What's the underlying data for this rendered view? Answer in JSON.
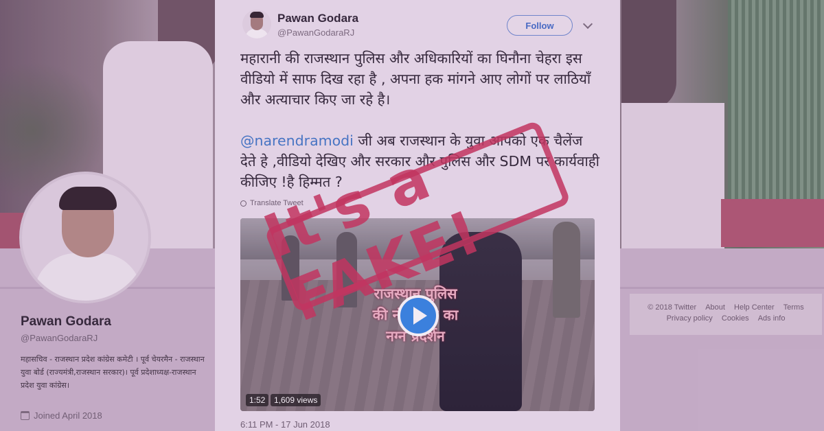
{
  "background": {
    "accent_color": "#c83058"
  },
  "profile": {
    "name": "Pawan Godara",
    "handle": "@PawanGodaraRJ",
    "bio": "महासचिव - राजस्थान प्रदेश कांग्रेस कमेटी । पूर्व चेयरमैन - राजस्थान युवा बोर्ड (राज्यमंत्री,राजस्थान सरकार)। पूर्व प्रदेशाध्यक्ष-राजस्थान प्रदेश युवा कांग्रेस।",
    "joined": "Joined April 2018"
  },
  "footer": {
    "row1": [
      "© 2018 Twitter",
      "About",
      "Help Center",
      "Terms"
    ],
    "row2": [
      "Privacy policy",
      "Cookies",
      "Ads info"
    ]
  },
  "tweet": {
    "name": "Pawan Godara",
    "handle": "@PawanGodaraRJ",
    "follow_label": "Follow",
    "para1": "महारानी की राजस्थान पुलिस और अधिकारियों का घिनौना चेहरा इस वीडियो में साफ दिख रहा है , अपना हक मांगने आए लोगों पर लाठियाँ और अत्याचार किए जा रहे है।",
    "mention": "@narendramodi",
    "para2_rest": " जी अब राजस्थान के युवा आपको एक चैलेंज देते हे ,वीडियो देखिए और सरकार और पुलिस और SDM पर कार्यवाही कीजिए !है हिम्मत ?",
    "translate_label": "Translate Tweet",
    "video": {
      "overlay_line1": "राजस्थान पुलिस",
      "overlay_line2": "की नंगा नाच का",
      "overlay_line3": "नग्न प्रदर्शन",
      "duration": "1:52",
      "views": "1,609 views"
    },
    "timestamp": "6:11 PM - 17 Jun 2018"
  },
  "stamp": {
    "text": "It's a FAKE!"
  }
}
